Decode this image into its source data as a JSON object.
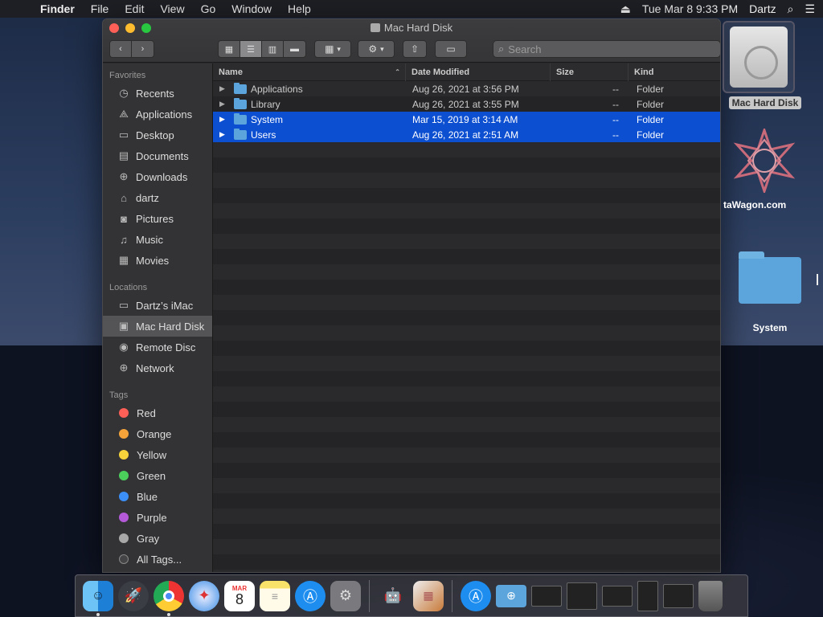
{
  "menubar": {
    "items": [
      "Finder",
      "File",
      "Edit",
      "View",
      "Go",
      "Window",
      "Help"
    ],
    "datetime": "Tue Mar 8  9:33 PM",
    "user": "Dartz",
    "icons": [
      "apple-icon",
      "eject-icon",
      "spotlight-icon",
      "notification-center-icon"
    ]
  },
  "window": {
    "title": "Mac Hard Disk",
    "search_placeholder": "Search",
    "sidebar": {
      "favorites_header": "Favorites",
      "favorites": [
        {
          "label": "Recents",
          "icon": "clock-icon"
        },
        {
          "label": "Applications",
          "icon": "applications-icon"
        },
        {
          "label": "Desktop",
          "icon": "desktop-icon"
        },
        {
          "label": "Documents",
          "icon": "document-icon"
        },
        {
          "label": "Downloads",
          "icon": "download-icon"
        },
        {
          "label": "dartz",
          "icon": "home-icon"
        },
        {
          "label": "Pictures",
          "icon": "camera-icon"
        },
        {
          "label": "Music",
          "icon": "music-note-icon"
        },
        {
          "label": "Movies",
          "icon": "film-icon"
        }
      ],
      "locations_header": "Locations",
      "locations": [
        {
          "label": "Dartz’s iMac",
          "icon": "imac-icon"
        },
        {
          "label": "Mac Hard Disk",
          "icon": "hard-disk-icon",
          "selected": true
        },
        {
          "label": "Remote Disc",
          "icon": "disc-icon"
        },
        {
          "label": "Network",
          "icon": "globe-icon"
        }
      ],
      "tags_header": "Tags",
      "tags": [
        {
          "label": "Red",
          "color": "#fe5f57"
        },
        {
          "label": "Orange",
          "color": "#f6a43a"
        },
        {
          "label": "Yellow",
          "color": "#f7d33b"
        },
        {
          "label": "Green",
          "color": "#4cd05c"
        },
        {
          "label": "Blue",
          "color": "#3b8ff6"
        },
        {
          "label": "Purple",
          "color": "#b45ad8"
        },
        {
          "label": "Gray",
          "color": "#a8a8a8"
        },
        {
          "label": "All Tags...",
          "color": "#444446"
        }
      ]
    },
    "columns": {
      "name": "Name",
      "date": "Date Modified",
      "size": "Size",
      "kind": "Kind"
    },
    "files": [
      {
        "name": "Applications",
        "date": "Aug 26, 2021 at 3:56 PM",
        "size": "--",
        "kind": "Folder",
        "selected": false
      },
      {
        "name": "Library",
        "date": "Aug 26, 2021 at 3:55 PM",
        "size": "--",
        "kind": "Folder",
        "selected": false
      },
      {
        "name": "System",
        "date": "Mar 15, 2019 at 3:14 AM",
        "size": "--",
        "kind": "Folder",
        "selected": true
      },
      {
        "name": "Users",
        "date": "Aug 26, 2021 at 2:51 AM",
        "size": "--",
        "kind": "Folder",
        "selected": true
      }
    ]
  },
  "desktop": {
    "icons": [
      {
        "label": "Mac Hard Disk"
      },
      {
        "label": "taWagon.com"
      },
      {
        "label": "System"
      }
    ]
  },
  "dock": {
    "apps": [
      "finder-icon",
      "launchpad-icon",
      "chrome-icon",
      "safari-icon",
      "calendar-icon",
      "notes-icon",
      "app-store-icon",
      "system-preferences-icon",
      "automator-icon",
      "preview-icon",
      "app-store-download-icon",
      "folder-download-icon",
      "window-thumb-1",
      "window-thumb-2",
      "window-thumb-3",
      "window-thumb-4",
      "window-thumb-5",
      "trash-icon"
    ],
    "calendar_month": "MAR",
    "calendar_day": "8"
  }
}
